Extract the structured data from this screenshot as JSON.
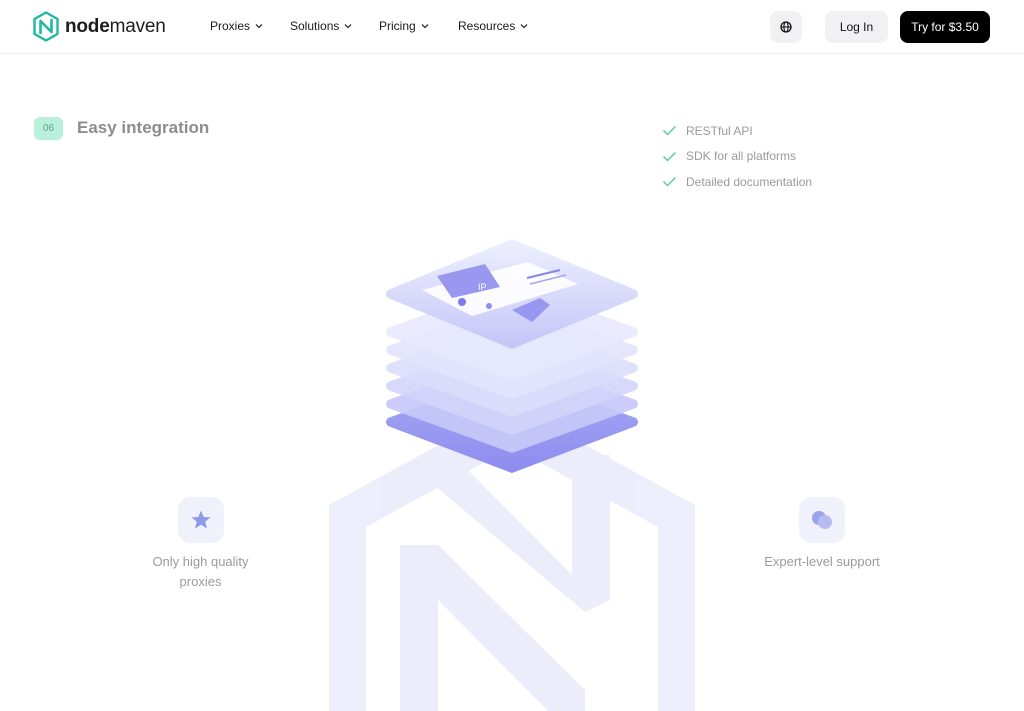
{
  "brand": {
    "name_bold": "node",
    "name_light": "maven",
    "accent": "#1fb8a0"
  },
  "nav": {
    "items": [
      {
        "label": "Proxies"
      },
      {
        "label": "Solutions"
      },
      {
        "label": "Pricing"
      },
      {
        "label": "Resources"
      }
    ],
    "language_icon": "globe-icon",
    "login_label": "Log In",
    "cta_label": "Try for $3.50"
  },
  "section": {
    "number": "06",
    "title": "Easy integration",
    "features": [
      {
        "label": "RESTful API",
        "icon": "check-icon"
      },
      {
        "label": "SDK for all platforms",
        "icon": "check-icon"
      },
      {
        "label": "Detailed documentation",
        "icon": "check-icon"
      }
    ],
    "check_color": "#5ccaa6"
  },
  "illustration": {
    "card_text": "IP",
    "left_card": {
      "label_line1": "Only high quality",
      "label_line2": "proxies",
      "icon": "star-icon"
    },
    "right_card": {
      "label": "Expert-level support",
      "icon": "chat-bubbles-icon"
    },
    "colors": {
      "layer": "#d9dbfb",
      "layer_edge": "#b5b7f5",
      "accent": "#8a89f2",
      "background_mark": "#ecedfb"
    }
  }
}
